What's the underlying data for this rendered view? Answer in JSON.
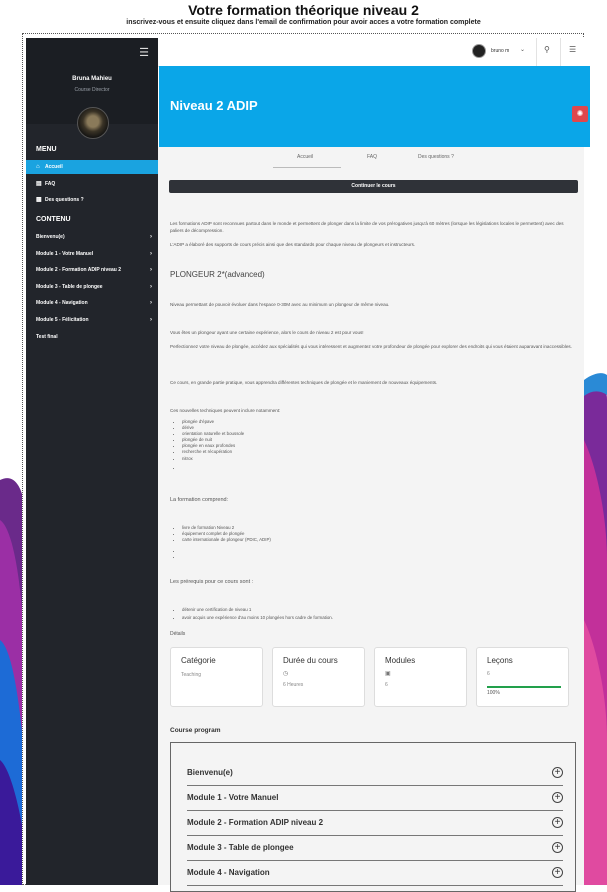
{
  "page": {
    "title": "Votre formation théorique niveau 2",
    "subtitle": "inscrivez-vous et ensuite cliquez dans l'email de confirmation pour avoir acces a votre formation complete"
  },
  "sidebar": {
    "user_name": "Bruna Mahieu",
    "user_role": "Course Director",
    "menu_heading": "MENU",
    "menu_items": [
      {
        "label": "Accueil",
        "icon": "home-icon",
        "active": true
      },
      {
        "label": "FAQ",
        "icon": "faq-icon"
      },
      {
        "label": "Des questions ?",
        "icon": "chat-icon"
      }
    ],
    "content_heading": "CONTENU",
    "content_items": [
      {
        "label": "Bienvenu(e)"
      },
      {
        "label": "Module 1 - Votre Manuel"
      },
      {
        "label": "Module 2 - Formation ADIP niveau 2"
      },
      {
        "label": "Module 3 - Table de plongee"
      },
      {
        "label": "Module 4 - Navigation"
      },
      {
        "label": "Module 5 - Félicitation"
      },
      {
        "label": "Test final"
      }
    ]
  },
  "topbar": {
    "username": "bruno m",
    "icons": [
      "search-icon",
      "list-icon"
    ]
  },
  "hero": {
    "title": "Niveau 2 ADIP"
  },
  "tabs": [
    "Accueil",
    "FAQ",
    "Des questions ?"
  ],
  "continue_label": "Continuer le cours",
  "content": {
    "intro1": "Les formations ADIP sont reconnues partout dans le monde et permettent de plonger dans la limite de vos prérogatives jusqu'à 60 mètres (lorsque les législations locales le permettent) avec des paliers de décompression.",
    "intro2": "L'ADIP a élaboré des supports de cours précis ainsi que des standards pour chaque niveau de plongeurs et instructeurs.",
    "level_heading": "PLONGEUR 2*(advanced)",
    "level_desc": "Niveau permettant de pouvoir évoluer dans l'espace 0-30M avec au minimum un plongeur de même niveau.",
    "p1": "Vous êtes un plongeur ayant une certaine expérience, alors le cours de niveau 2 est pour vous!",
    "p2": "Perfectionnez votre niveau de plongée, accédez aux spécialités qui vous intéressent et augmentez votre profondeur de plongée pour explorer des endroits qui vous étaient auparavant inaccessibles.",
    "p3": "Ce cours, en grande partie pratique, vous apprendra différentes techniques de plongée et le maniement de nouveaux équipements.",
    "techniques_intro": "Ces nouvelles techniques peuvent inclure notamment:",
    "techniques": [
      "plongée d'épave",
      "dérive",
      "orientation naturelle et boussole",
      "plongée de nuit",
      "plongée en eaux profondes",
      "recherche et récupération",
      "nitrox",
      ""
    ],
    "formation_heading": "La formation comprend:",
    "formation_items": [
      "livre de formation Niveau 2",
      "équipement complet de plongée",
      "carte internationale de plongeur (PDIC, ADIP)",
      "",
      ""
    ],
    "prereq_heading": "Les prérequis pour ce cours sont :",
    "prereq_items": [
      "détenir une certification de niveau 1",
      "avoir acquis une expérience d'au moins 10 plongées hors cadre de formation."
    ],
    "details_label": "Détails"
  },
  "cards": [
    {
      "title": "Catégorie",
      "value": "Teaching",
      "icon": ""
    },
    {
      "title": "Durée du cours",
      "value": "6 Heures",
      "icon": "clock-icon"
    },
    {
      "title": "Modules",
      "value": "6",
      "icon": "calendar-icon"
    },
    {
      "title": "Leçons",
      "value": "6",
      "progress_label": "100%",
      "progress": 1.0
    }
  ],
  "course_program": {
    "title": "Course program",
    "items": [
      "Bienvenu(e)",
      "Module 1 - Votre Manuel",
      "Module 2 - Formation ADIP niveau 2",
      "Module 3 - Table de plongee",
      "Module 4 - Navigation"
    ]
  },
  "colors": {
    "accent": "#0aa6e8",
    "sidebar": "#22252b",
    "active": "#1aa3e0",
    "danger": "#e0474c",
    "progress": "#22a04b"
  }
}
